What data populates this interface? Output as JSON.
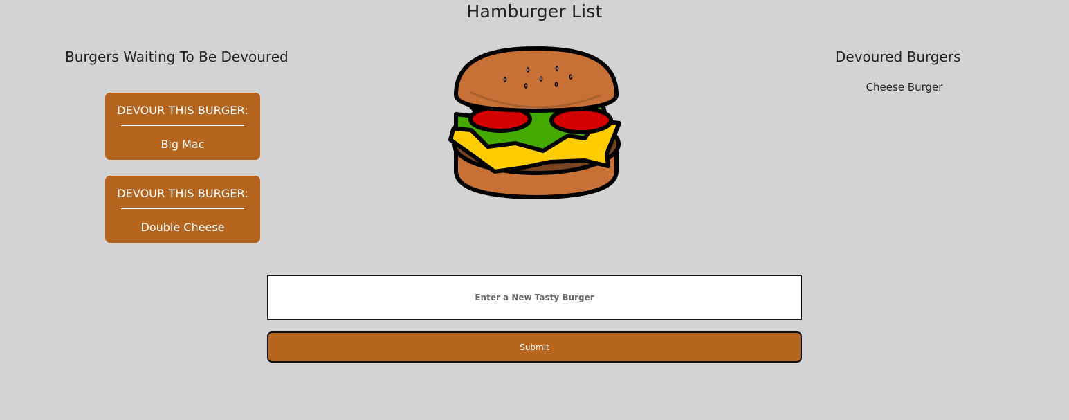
{
  "page": {
    "title": "Hamburger List"
  },
  "waiting": {
    "heading": "Burgers Waiting To Be Devoured",
    "items": [
      {
        "action_label": "DEVOUR THIS BURGER:",
        "name": "Big Mac"
      },
      {
        "action_label": "DEVOUR THIS BURGER:",
        "name": "Double Cheese"
      }
    ]
  },
  "devoured": {
    "heading": "Devoured Burgers",
    "items": [
      {
        "name": "Cheese Burger"
      }
    ]
  },
  "form": {
    "placeholder": "Enter a New Tasty Burger",
    "value": "",
    "submit_label": "Submit"
  },
  "illustration": {
    "icon": "hamburger-illustration"
  },
  "colors": {
    "background": "#d3d3d3",
    "accent": "#b5651d",
    "bun": "#c87137",
    "lettuce": "#44aa00",
    "tomato": "#d40000",
    "cheese": "#ffcc00",
    "patty": "#784421"
  }
}
